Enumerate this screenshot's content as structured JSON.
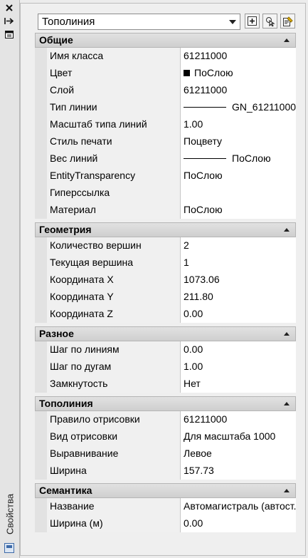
{
  "palette": {
    "title": "Свойства",
    "object_type": "Тополиния"
  },
  "sections": [
    {
      "title": "Общие",
      "rows": [
        {
          "label": "Имя класса",
          "value": "61211000"
        },
        {
          "label": "Цвет",
          "value": "ПоСлою",
          "kind": "color"
        },
        {
          "label": "Слой",
          "value": "61211000"
        },
        {
          "label": "Тип линии",
          "value": "GN_61211000",
          "kind": "line"
        },
        {
          "label": "Масштаб типа линий",
          "value": "1.00"
        },
        {
          "label": "Стиль печати",
          "value": "Поцвету"
        },
        {
          "label": "Вес линий",
          "value": "ПоСлою",
          "kind": "line"
        },
        {
          "label": "EntityTransparency",
          "value": "ПоСлою"
        },
        {
          "label": "Гиперссылка",
          "value": ""
        },
        {
          "label": "Материал",
          "value": "ПоСлою"
        }
      ]
    },
    {
      "title": "Геометрия",
      "rows": [
        {
          "label": "Количество вершин",
          "value": "2"
        },
        {
          "label": "Текущая вершина",
          "value": "1"
        },
        {
          "label": "Координата X",
          "value": "1073.06"
        },
        {
          "label": "Координата Y",
          "value": "211.80"
        },
        {
          "label": "Координата Z",
          "value": "0.00"
        }
      ]
    },
    {
      "title": "Разное",
      "rows": [
        {
          "label": "Шаг по линиям",
          "value": "0.00"
        },
        {
          "label": "Шаг по дугам",
          "value": "1.00"
        },
        {
          "label": "Замкнутость",
          "value": "Нет"
        }
      ]
    },
    {
      "title": "Тополиния",
      "rows": [
        {
          "label": "Правило отрисовки",
          "value": "61211000"
        },
        {
          "label": "Вид отрисовки",
          "value": "Для масштаба 1000"
        },
        {
          "label": "Выравнивание",
          "value": "Левое"
        },
        {
          "label": "Ширина",
          "value": "157.73"
        }
      ]
    },
    {
      "title": "Семантика",
      "rows": [
        {
          "label": "Название",
          "value": "Автомагистраль (автост..."
        },
        {
          "label": "Ширина (м)",
          "value": "0.00"
        }
      ]
    }
  ],
  "icons": {
    "close": "close-icon",
    "autohide": "autohide-icon",
    "properties_menu": "properties-menu-icon",
    "pickadd": "pickadd-icon",
    "select_objects": "select-objects-icon",
    "quick_select": "quick-select-icon"
  }
}
